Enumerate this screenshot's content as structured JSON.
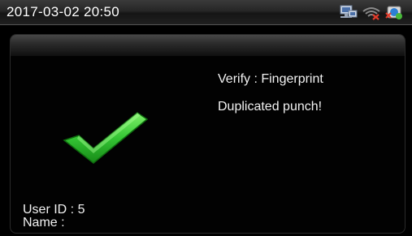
{
  "status_bar": {
    "datetime": "2017-03-02 20:50",
    "icons": [
      "network-icon",
      "wifi-disconnected-icon",
      "server-status-icon"
    ]
  },
  "result": {
    "icon": "green-checkmark-icon",
    "verify_line": "Verify : Fingerprint",
    "message": "Duplicated punch!"
  },
  "user": {
    "id_line": "User ID : 5",
    "name_line": "Name :"
  },
  "colors": {
    "background": "#000000",
    "text": "#f2f2f2",
    "check_green": "#3fcf3f"
  }
}
